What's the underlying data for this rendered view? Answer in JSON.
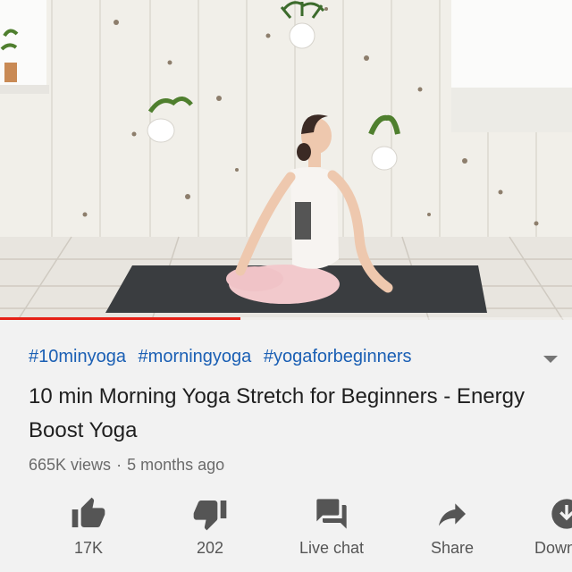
{
  "video": {
    "progress_fraction": 0.42,
    "progress_color": "#e62117"
  },
  "description": {
    "hashtags": [
      "#10minyoga",
      "#morningyoga",
      "#yogaforbeginners"
    ],
    "title": "10 min Morning Yoga Stretch for Beginners - Energy Boost Yoga",
    "views": "665K views",
    "separator": "·",
    "age": "5 months ago"
  },
  "actions": {
    "like": {
      "label": "17K",
      "icon": "thumbs-up-icon"
    },
    "dislike": {
      "label": "202",
      "icon": "thumbs-down-icon"
    },
    "live_chat": {
      "label": "Live chat",
      "icon": "chat-icon"
    },
    "share": {
      "label": "Share",
      "icon": "share-arrow-icon"
    },
    "download": {
      "label": "Download",
      "icon": "download-icon"
    }
  },
  "colors": {
    "hashtag": "#1a5fb4",
    "icon": "#555555",
    "panel_bg": "#f2f2f2"
  }
}
